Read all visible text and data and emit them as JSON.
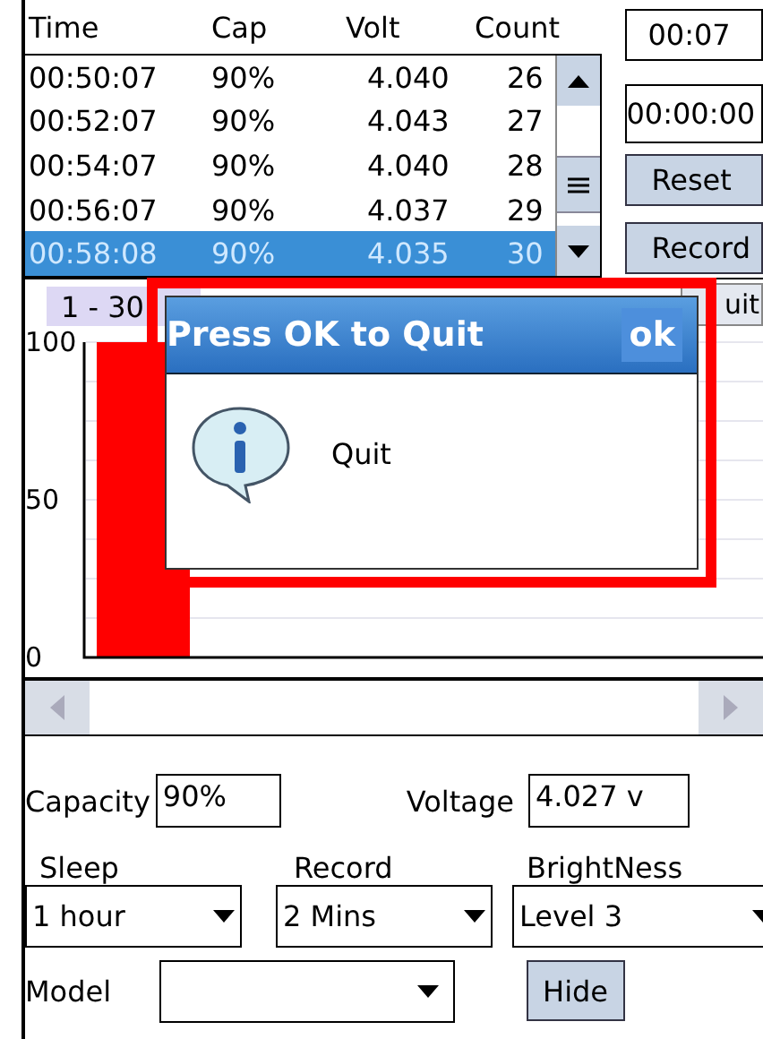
{
  "table": {
    "columns": [
      "Time",
      "Cap",
      "Volt",
      "Count"
    ],
    "rows": [
      {
        "cells": [
          "00:50:07",
          "90%",
          "4.040",
          "26"
        ],
        "selected": false
      },
      {
        "cells": [
          "00:52:07",
          "90%",
          "4.043",
          "27"
        ],
        "selected": false
      },
      {
        "cells": [
          "00:54:07",
          "90%",
          "4.040",
          "28"
        ],
        "selected": false
      },
      {
        "cells": [
          "00:56:07",
          "90%",
          "4.037",
          "29"
        ],
        "selected": false
      },
      {
        "cells": [
          "00:58:08",
          "90%",
          "4.035",
          "30"
        ],
        "selected": true
      }
    ]
  },
  "timer": "00:07",
  "elapsed": "00:00:00",
  "buttons": [
    "Reset",
    "Record"
  ],
  "chart": {
    "tab": "1 - 30",
    "quit_button": "uit",
    "chart_data": {
      "type": "bar",
      "values": [
        100
      ],
      "ylim": [
        0,
        100
      ],
      "yticks": [
        0,
        50,
        100
      ]
    }
  },
  "dialog": {
    "title": "Press OK to Quit",
    "ok": "ok",
    "message": "Quit"
  },
  "readings": [
    {
      "label": "Capacity",
      "value": "90%"
    },
    {
      "label": "Voltage",
      "value": "4.027 v"
    }
  ],
  "selects": [
    {
      "label": "Sleep",
      "value": "1 hour"
    },
    {
      "label": "Record",
      "value": "2 Mins"
    },
    {
      "label": "BrightNess",
      "value": "Level 3"
    }
  ],
  "model": {
    "label": "Model"
  },
  "hide_button": "Hide"
}
